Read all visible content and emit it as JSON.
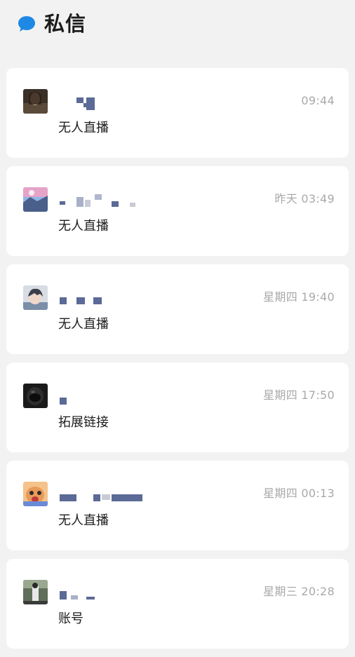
{
  "header": {
    "title": "私信",
    "icon": "chat-bubble-icon",
    "accent": "#1e88e5"
  },
  "conversations": [
    {
      "avatar": "avatar-dark-photo",
      "time": "09:44",
      "message": "无人直播"
    },
    {
      "avatar": "avatar-anime-sky",
      "time": "昨天 03:49",
      "message": "无人直播"
    },
    {
      "avatar": "avatar-anime-boy",
      "time": "星期四 19:40",
      "message": "无人直播"
    },
    {
      "avatar": "avatar-black-helmet",
      "time": "星期四 17:50",
      "message": "拓展链接"
    },
    {
      "avatar": "avatar-cartoon-face",
      "time": "星期四 00:13",
      "message": "无人直播"
    },
    {
      "avatar": "avatar-street-photo",
      "time": "星期三 20:28",
      "message": "账号"
    }
  ],
  "colors": {
    "background": "#f2f2f2",
    "card": "#ffffff",
    "time_text": "#a9a9a9",
    "redaction": "#5b6a96"
  }
}
